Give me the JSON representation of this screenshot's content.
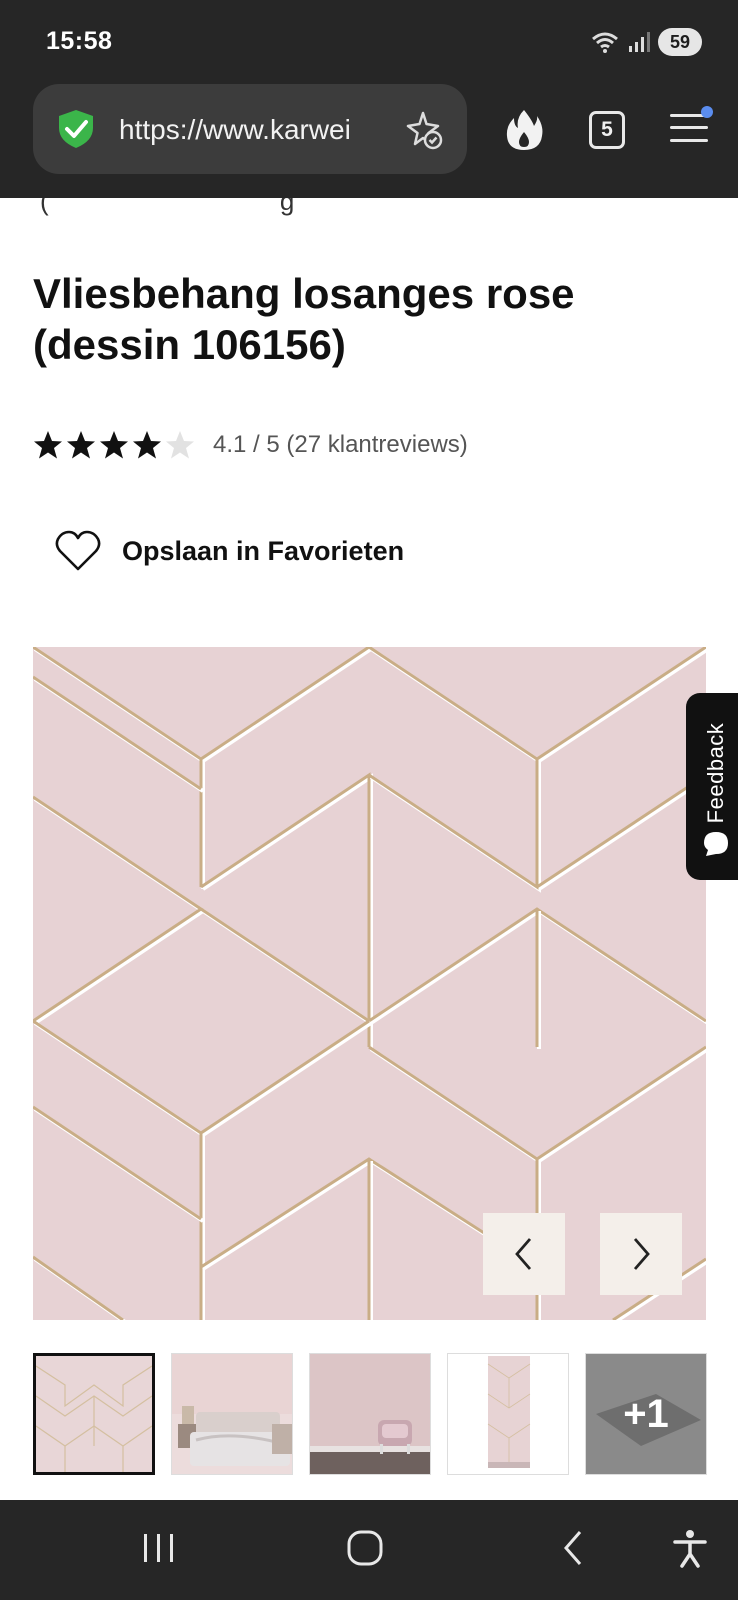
{
  "status_bar": {
    "time": "15:58",
    "battery": "59",
    "icons": [
      "wifi-icon",
      "signal-icon",
      "battery-icon"
    ]
  },
  "browser": {
    "url": "https://www.karwei",
    "tab_count": "5",
    "icons": [
      "shield-check-icon",
      "ai-star-icon",
      "flame-icon",
      "tabs-icon",
      "menu-icon"
    ]
  },
  "product": {
    "title": "Vliesbehang losanges rose (dessin 106156)",
    "rating": 4.1,
    "rating_max": 5,
    "rating_text": "4.1 / 5 (27 klantreviews)",
    "favorite_label": "Opslaan in Favorieten"
  },
  "gallery": {
    "current_index": 1,
    "thumbnail_count": 5,
    "more_label": "+1",
    "thumbnails": [
      "pattern-close-up",
      "bedroom-scene",
      "living-room-scene",
      "wallpaper-roll",
      "more-images"
    ]
  },
  "feedback": {
    "label": "Feedback"
  },
  "android_nav": {
    "icons": [
      "recent-apps-icon",
      "home-icon",
      "back-icon",
      "accessibility-icon"
    ]
  },
  "colors": {
    "chrome_bg": "#262626",
    "urlbar_bg": "#3c3c3c",
    "wallpaper_pink": "#e7d2d4",
    "pattern_gold": "#c9ad86",
    "shield_green": "#3bb54a",
    "notification_dot": "#5b8def"
  }
}
